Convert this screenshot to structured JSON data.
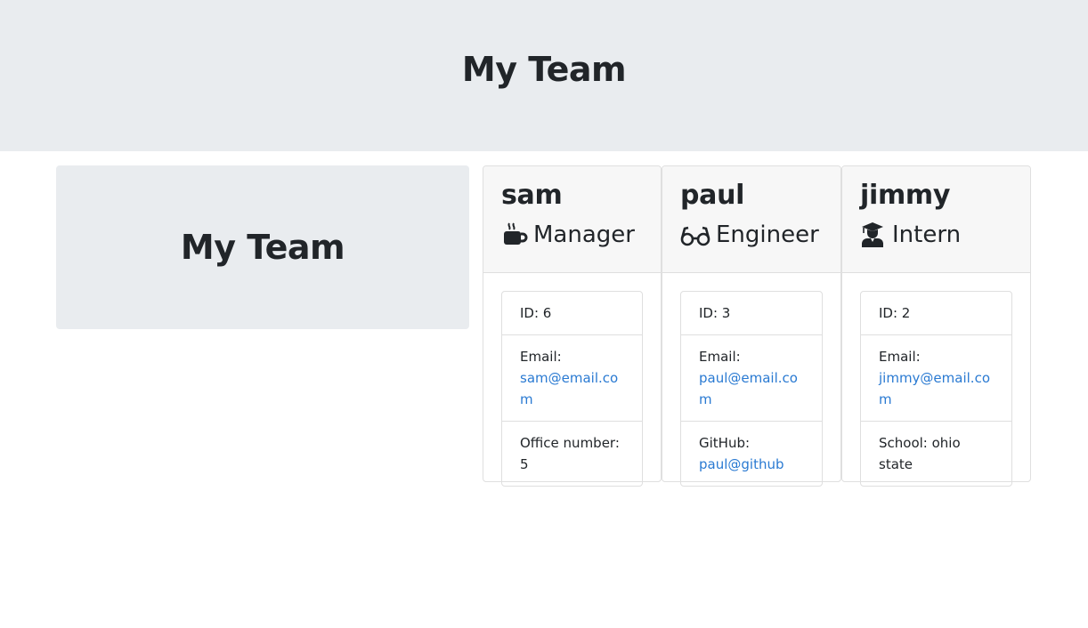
{
  "header": {
    "title": "My Team"
  },
  "side": {
    "title": "My Team"
  },
  "members": [
    {
      "name": "sam",
      "role": "Manager",
      "role_icon": "mug-hot-icon",
      "id_text": "ID: 6",
      "email_label": "Email:",
      "email": "sam@email.com",
      "extra": "Office number:",
      "extra_value": "5"
    },
    {
      "name": "paul",
      "role": "Engineer",
      "role_icon": "glasses-icon",
      "id_text": "ID: 3",
      "email_label": "Email:",
      "email": "paul@email.com",
      "extra": "GitHub:",
      "extra_value": "paul@github"
    },
    {
      "name": "jimmy",
      "role": "Intern",
      "role_icon": "graduate-icon",
      "id_text": "ID: 2",
      "email_label": "Email:",
      "email": "jimmy@email.com",
      "extra": "School: ohio state"
    }
  ],
  "colors": {
    "jumbotron": "#e9ecef",
    "link": "#2a7ad2",
    "card_header": "#f7f7f7"
  }
}
